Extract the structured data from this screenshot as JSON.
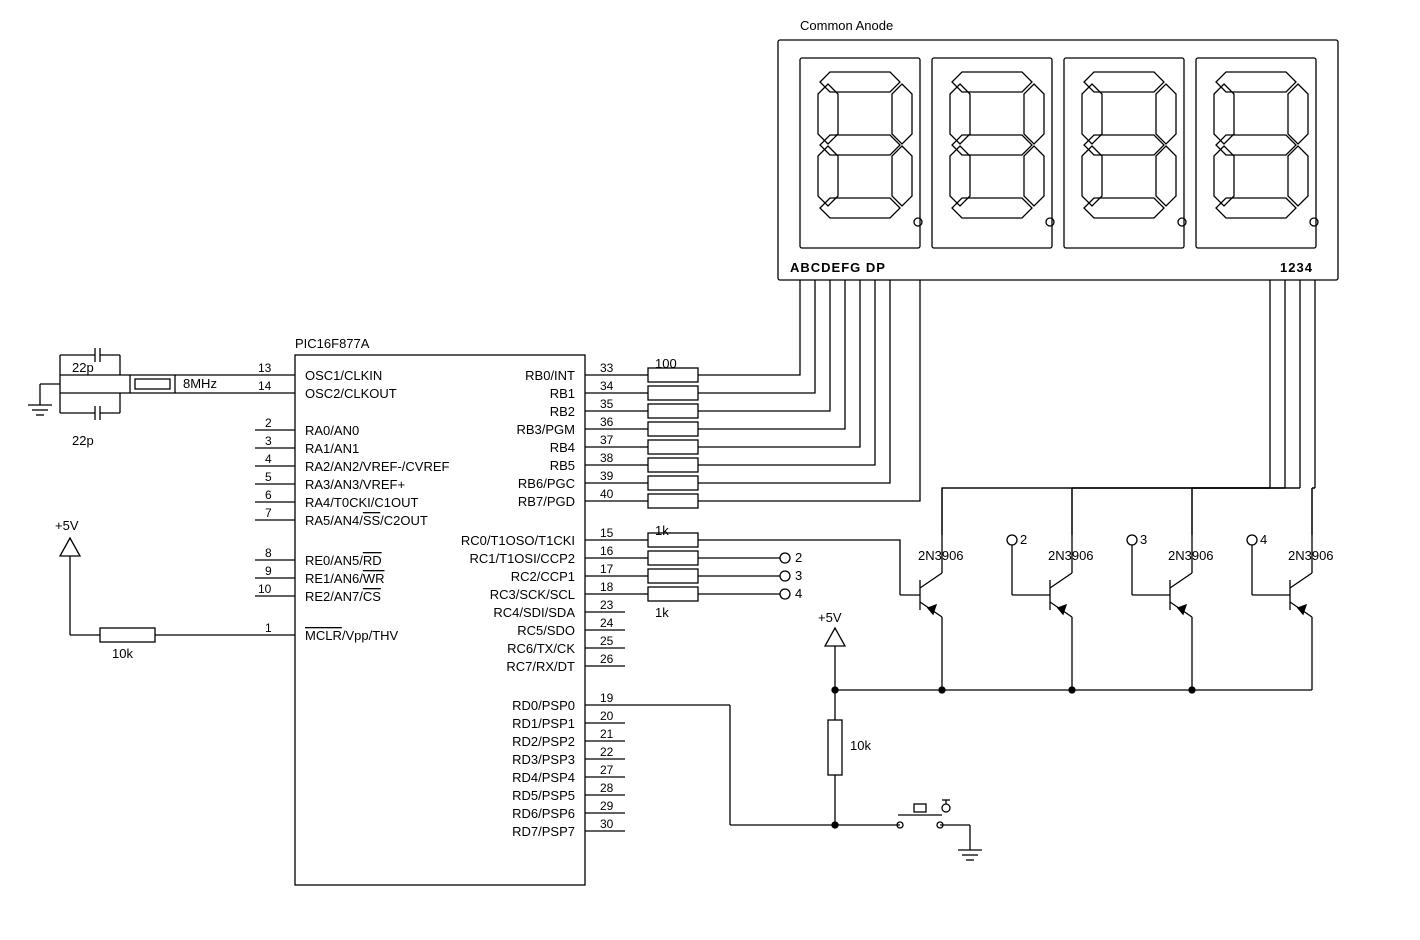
{
  "title": "Common Anode",
  "mcu": {
    "part": "PIC16F877A",
    "osc_freq": "8MHz",
    "cap1": "22p",
    "cap2": "22p",
    "vcc": "+5V",
    "mclr_r": "10k",
    "left_pins": [
      {
        "num": "13",
        "name": "OSC1/CLKIN"
      },
      {
        "num": "14",
        "name": "OSC2/CLKOUT"
      },
      {
        "num": "2",
        "name": "RA0/AN0"
      },
      {
        "num": "3",
        "name": "RA1/AN1"
      },
      {
        "num": "4",
        "name": "RA2/AN2/VREF-/CVREF"
      },
      {
        "num": "5",
        "name": "RA3/AN3/VREF+"
      },
      {
        "num": "6",
        "name": "RA4/T0CKI/C1OUT"
      },
      {
        "num": "7",
        "name": "RA5/AN4/SS/C2OUT"
      },
      {
        "num": "8",
        "name": "RE0/AN5/RD"
      },
      {
        "num": "9",
        "name": "RE1/AN6/WR"
      },
      {
        "num": "10",
        "name": "RE2/AN7/CS"
      },
      {
        "num": "1",
        "name": "MCLR/Vpp/THV"
      }
    ],
    "right_pins": [
      {
        "num": "33",
        "name": "RB0/INT"
      },
      {
        "num": "34",
        "name": "RB1"
      },
      {
        "num": "35",
        "name": "RB2"
      },
      {
        "num": "36",
        "name": "RB3/PGM"
      },
      {
        "num": "37",
        "name": "RB4"
      },
      {
        "num": "38",
        "name": "RB5"
      },
      {
        "num": "39",
        "name": "RB6/PGC"
      },
      {
        "num": "40",
        "name": "RB7/PGD"
      },
      {
        "num": "15",
        "name": "RC0/T1OSO/T1CKI"
      },
      {
        "num": "16",
        "name": "RC1/T1OSI/CCP2"
      },
      {
        "num": "17",
        "name": "RC2/CCP1"
      },
      {
        "num": "18",
        "name": "RC3/SCK/SCL"
      },
      {
        "num": "23",
        "name": "RC4/SDI/SDA"
      },
      {
        "num": "24",
        "name": "RC5/SDO"
      },
      {
        "num": "25",
        "name": "RC6/TX/CK"
      },
      {
        "num": "26",
        "name": "RC7/RX/DT"
      },
      {
        "num": "19",
        "name": "RD0/PSP0"
      },
      {
        "num": "20",
        "name": "RD1/PSP1"
      },
      {
        "num": "21",
        "name": "RD2/PSP2"
      },
      {
        "num": "22",
        "name": "RD3/PSP3"
      },
      {
        "num": "27",
        "name": "RD4/PSP4"
      },
      {
        "num": "28",
        "name": "RD5/PSP5"
      },
      {
        "num": "29",
        "name": "RD6/PSP6"
      },
      {
        "num": "30",
        "name": "RD7/PSP7"
      }
    ]
  },
  "segment_r": "100",
  "digit_r_top": "1k",
  "digit_r_bot": "1k",
  "transistor": "2N3906",
  "trans_labels": [
    "2",
    "3",
    "4"
  ],
  "display": {
    "left_label": "ABCDEFG  DP",
    "right_label": "1234"
  },
  "pullup": {
    "v": "+5V",
    "r": "10k"
  },
  "jumpers": [
    "2",
    "3",
    "4"
  ]
}
